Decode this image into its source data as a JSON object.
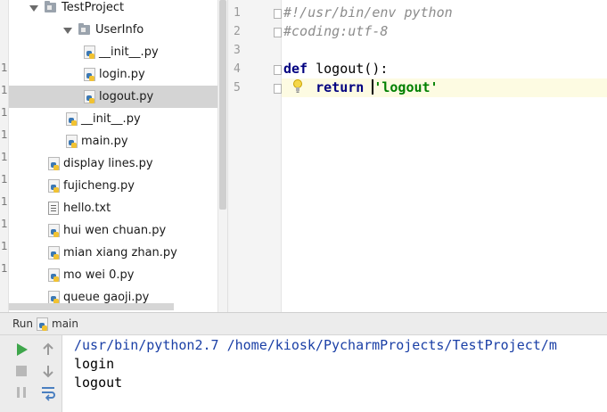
{
  "project_tree": {
    "gutter_numbers": [
      "1",
      "1",
      "1",
      "1",
      "1",
      "1",
      "1",
      "1",
      "1",
      "1"
    ],
    "rows": [
      {
        "label": "TestProject",
        "kind": "folder",
        "expanded": true,
        "depth": 1
      },
      {
        "label": "UserInfo",
        "kind": "folder",
        "expanded": true,
        "depth": 2
      },
      {
        "label": "__init__.py",
        "kind": "py",
        "depth": 3
      },
      {
        "label": "login.py",
        "kind": "py",
        "depth": 3
      },
      {
        "label": "logout.py",
        "kind": "py",
        "depth": 3,
        "selected": true
      },
      {
        "label": "__init__.py",
        "kind": "py",
        "depth": 2
      },
      {
        "label": "main.py",
        "kind": "py",
        "depth": 2
      },
      {
        "label": "display lines.py",
        "kind": "py",
        "depth": 1
      },
      {
        "label": "fujicheng.py",
        "kind": "py",
        "depth": 1
      },
      {
        "label": "hello.txt",
        "kind": "txt",
        "depth": 1
      },
      {
        "label": "hui wen chuan.py",
        "kind": "py",
        "depth": 1
      },
      {
        "label": "mian xiang zhan.py",
        "kind": "py",
        "depth": 1
      },
      {
        "label": "mo wei 0.py",
        "kind": "py",
        "depth": 1
      },
      {
        "label": "queue gaoji.py",
        "kind": "py",
        "depth": 1
      }
    ]
  },
  "editor": {
    "line_numbers": [
      "1",
      "2",
      "3",
      "4",
      "5"
    ],
    "lines": [
      {
        "segments": [
          {
            "text": "#!/usr/bin/env python",
            "style": "comment"
          }
        ]
      },
      {
        "segments": [
          {
            "text": "#coding:utf-8",
            "style": "comment"
          }
        ]
      },
      {
        "segments": []
      },
      {
        "segments": [
          {
            "text": "def",
            "style": "kw"
          },
          {
            "text": " logout():",
            "style": "plain"
          }
        ]
      },
      {
        "segments": [
          {
            "text": "    ",
            "style": "plain"
          },
          {
            "text": "return",
            "style": "kw"
          },
          {
            "text": " ",
            "style": "plain"
          },
          {
            "text": "'logout'",
            "style": "str"
          }
        ]
      }
    ],
    "caret_line": 5,
    "intention_icon": "lightbulb-icon"
  },
  "run_panel": {
    "label": "Run",
    "tab_label": "main",
    "toolbar_icons": [
      "run-icon",
      "scroll-up-icon",
      "stop-icon",
      "scroll-down-icon",
      "pause-icon",
      "soft-wrap-icon"
    ],
    "console_lines": [
      {
        "text": "/usr/bin/python2.7 /home/kiosk/PycharmProjects/TestProject/m",
        "kind": "cmd"
      },
      {
        "text": "login",
        "kind": "out"
      },
      {
        "text": "logout",
        "kind": "out"
      }
    ]
  },
  "colors": {
    "keyword": "#000080",
    "string": "#008000",
    "comment": "#8c8c8c",
    "console_command": "#1a3fa6",
    "selection": "#d4d4d4",
    "caret_row": "#fdfbe2"
  }
}
